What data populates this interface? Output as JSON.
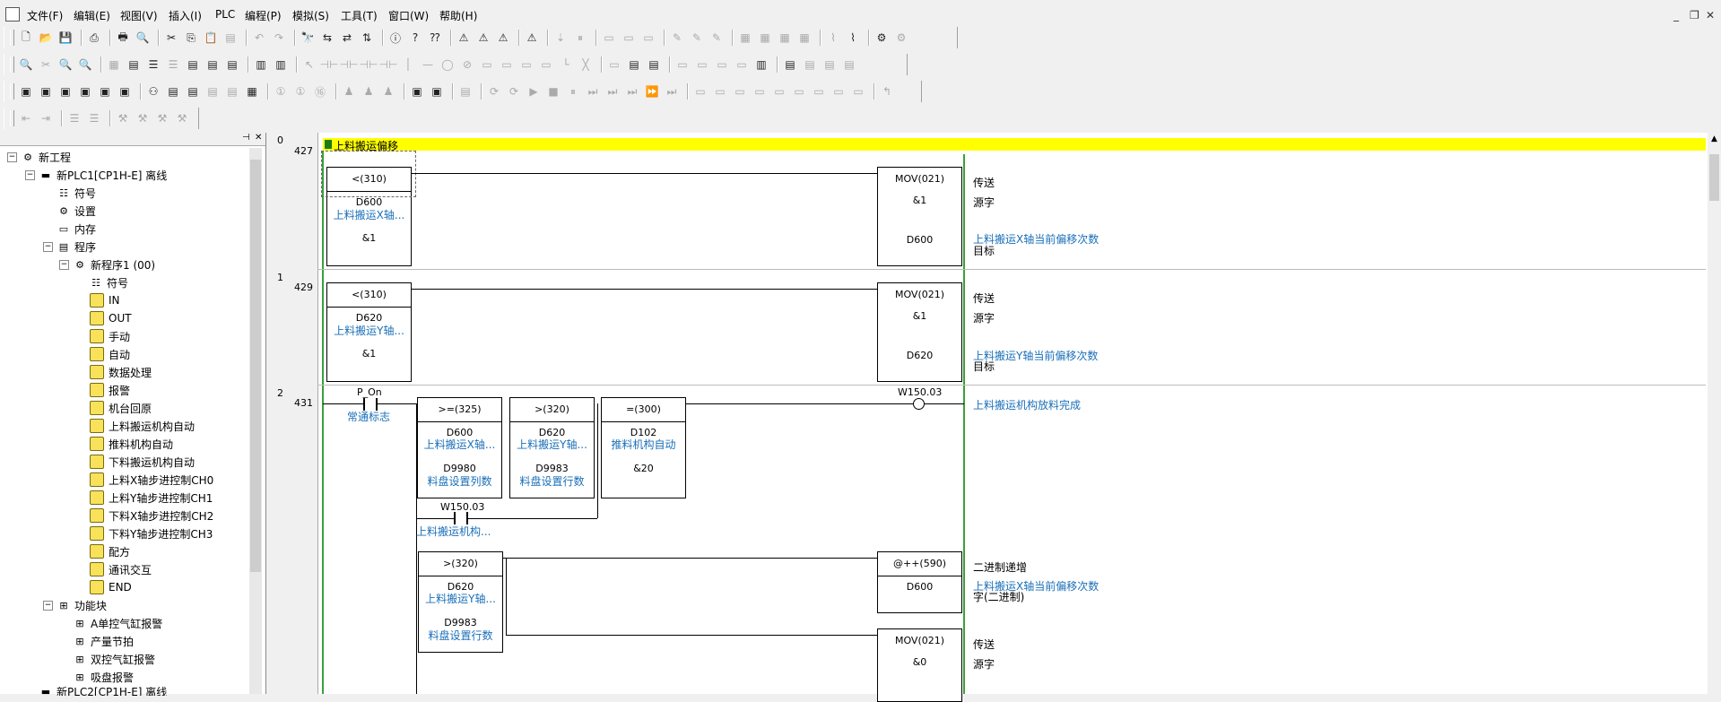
{
  "menubar": {
    "items": [
      "文件(F)",
      "编辑(E)",
      "视图(V)",
      "插入(I)",
      "PLC",
      "编程(P)",
      "模拟(S)",
      "工具(T)",
      "窗口(W)",
      "帮助(H)"
    ]
  },
  "tree": {
    "root": "新工程",
    "plc1": "新PLC1[CP1H-E] 离线",
    "symbols": "符号",
    "settings": "设置",
    "memory": "内存",
    "programs": "程序",
    "program1": "新程序1 (00)",
    "sections": [
      "符号",
      "IN",
      "OUT",
      "手动",
      "自动",
      "数据处理",
      "报警",
      "机台回原",
      "上料搬运机构自动",
      "推料机构自动",
      "下料搬运机构自动",
      "上料X轴步进控制CH0",
      "上料Y轴步进控制CH1",
      "下料X轴步进控制CH2",
      "下料Y轴步进控制CH3",
      "配方",
      "通讯交互",
      "END"
    ],
    "function_blocks": "功能块",
    "fbs": [
      "A单控气缸报警",
      "产量节拍",
      "双控气缸报警",
      "吸盘报警"
    ],
    "plc2": "新PLC2[CP1H-E] 离线"
  },
  "ladder": {
    "section_title": "上料搬运偏移",
    "rung0": {
      "num": "0",
      "addr": "427",
      "cmp_op": "<(310)",
      "cmp_a": "D600",
      "cmp_a_comment": "上料搬运X轴...",
      "cmp_b": "&1",
      "mov": "MOV(021)",
      "src": "&1",
      "dst": "D600",
      "op_label": "传送",
      "src_label": "源字",
      "dst_comment": "上料搬运X轴当前偏移次数",
      "dst_label": "目标"
    },
    "rung1": {
      "num": "1",
      "addr": "429",
      "cmp_op": "<(310)",
      "cmp_a": "D620",
      "cmp_a_comment": "上料搬运Y轴...",
      "cmp_b": "&1",
      "mov": "MOV(021)",
      "src": "&1",
      "dst": "D620",
      "op_label": "传送",
      "src_label": "源字",
      "dst_comment": "上料搬运Y轴当前偏移次数",
      "dst_label": "目标"
    },
    "rung2": {
      "num": "2",
      "addr": "431",
      "contact": "P_On",
      "contact_comment": "常通标志",
      "c1_op": ">=(325)",
      "c1_a": "D600",
      "c1_a_comment": "上料搬运X轴...",
      "c1_b": "D9980",
      "c1_b_comment": "料盘设置列数",
      "c2_op": ">(320)",
      "c2_a": "D620",
      "c2_a_comment": "上料搬运Y轴...",
      "c2_b": "D9983",
      "c2_b_comment": "料盘设置行数",
      "c3_op": "=(300)",
      "c3_a": "D102",
      "c3_a_comment": "推料机构自动",
      "c3_b": "&20",
      "coil": "W150.03",
      "coil_comment": "上料搬运机构放料完成",
      "branch_contact": "W150.03",
      "branch_comment": "上料搬运机构...",
      "c4_op": ">(320)",
      "c4_a": "D620",
      "c4_a_comment": "上料搬运Y轴...",
      "c4_b": "D9983",
      "c4_b_comment": "料盘设置行数",
      "inc": "@++(590)",
      "inc_arg": "D600",
      "inc_label": "二进制递增",
      "inc_comment": "上料搬运X轴当前偏移次数",
      "inc_label2": "字(二进制)",
      "mov2": "MOV(021)",
      "mov2_src": "&0",
      "mov2_label": "传送",
      "mov2_src_label": "源字"
    }
  }
}
